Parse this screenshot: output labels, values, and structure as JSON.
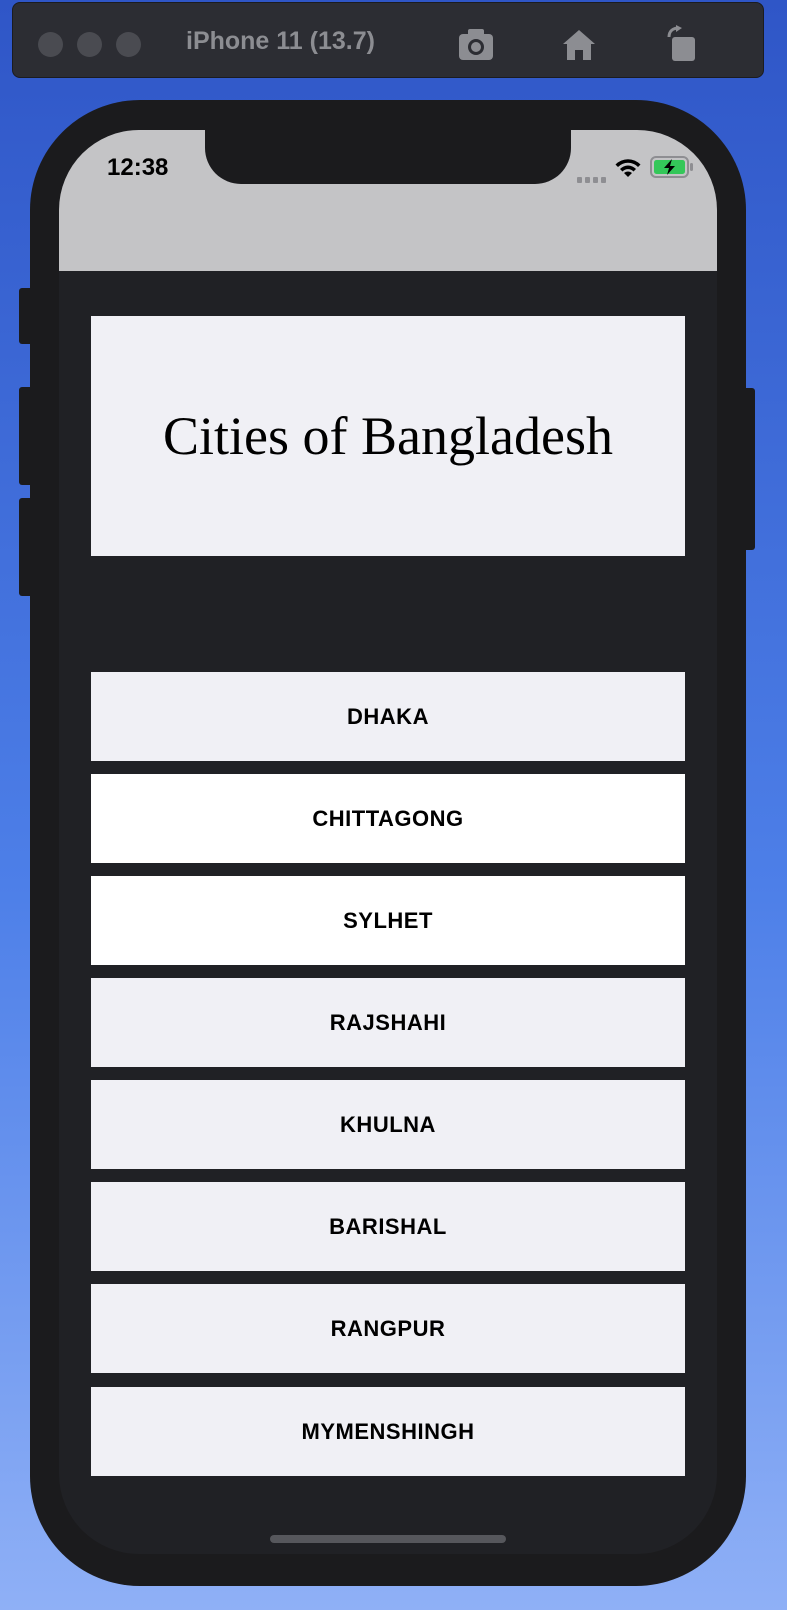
{
  "window": {
    "title": "iPhone 11 (13.7)",
    "toolbar_icons": [
      "screenshot-icon",
      "home-icon",
      "rotate-icon"
    ]
  },
  "status_bar": {
    "time": "12:38",
    "icons": [
      "cellular-signal-icon",
      "wifi-icon",
      "battery-charging-icon"
    ]
  },
  "app": {
    "title": "Cities of Bangladesh",
    "cities": [
      {
        "label": "DHAKA",
        "bg": "#f0f0f5"
      },
      {
        "label": "CHITTAGONG",
        "bg": "#ffffff"
      },
      {
        "label": "SYLHET",
        "bg": "#ffffff"
      },
      {
        "label": "RAJSHAHI",
        "bg": "#f0f0f5"
      },
      {
        "label": "KHULNA",
        "bg": "#f0f0f5"
      },
      {
        "label": "BARISHAL",
        "bg": "#f0f0f5"
      },
      {
        "label": "RANGPUR",
        "bg": "#f0f0f5"
      },
      {
        "label": "MYMENSHINGH",
        "bg": "#f0f0f5"
      }
    ]
  },
  "colors": {
    "screen_background": "#202125",
    "card_background": "#f0f0f5",
    "status_bar_background": "#c4c4c6"
  }
}
